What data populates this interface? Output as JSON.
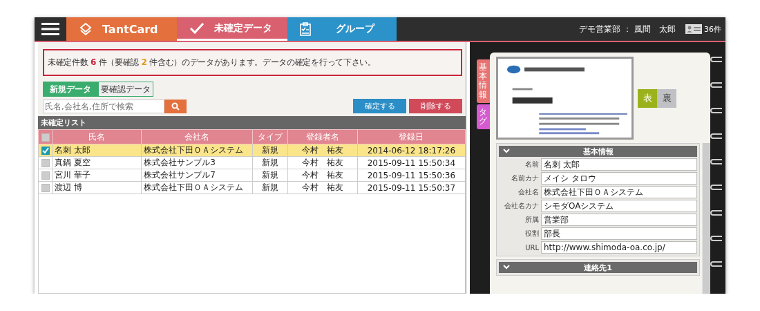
{
  "header": {
    "tabs": [
      {
        "kind": "brand",
        "label": "TantCard",
        "selected": false
      },
      {
        "kind": "check",
        "label": "未確定データ",
        "selected": true
      },
      {
        "kind": "group",
        "label": "グループ",
        "selected": false
      }
    ],
    "user": "デモ営業部 ： 風間　太郎",
    "count": "36件"
  },
  "notice": "未確定件数 **6** 件（要確認 **2** 件含む）のデータがあります。データの確定を行って下さい。",
  "subtabs": [
    {
      "label": "新規データ",
      "selected": true
    },
    {
      "label": "要確認データ",
      "selected": false
    }
  ],
  "search": {
    "placeholder": "氏名,会社名,住所で検索"
  },
  "buttons": [
    {
      "kind": "confirm",
      "label": "確定する"
    },
    {
      "kind": "delete",
      "label": "削除する"
    }
  ],
  "list": {
    "title": "未確定リスト",
    "all_checked": false,
    "columns": [
      "氏名",
      "会社名",
      "タイプ",
      "登録者名",
      "登録日"
    ],
    "rows": [
      {
        "checked": true,
        "selected": true,
        "cells": [
          "名刺 太郎",
          "株式会社下田ＯＡシステム",
          "新規",
          "今村　祐友",
          "2014-06-12 18:17:26"
        ]
      },
      {
        "checked": false,
        "selected": false,
        "cells": [
          "真鍋 夏空",
          "株式会社サンプル3",
          "新規",
          "今村　祐友",
          "2015-09-11 15:50:34"
        ]
      },
      {
        "checked": false,
        "selected": false,
        "cells": [
          "宮川 華子",
          "株式会社サンプル7",
          "新規",
          "今村　祐友",
          "2015-09-11 15:50:36"
        ]
      },
      {
        "checked": false,
        "selected": false,
        "cells": [
          "渡辺 博",
          "株式会社下田ＯＡシステム",
          "新規",
          "今村　祐友",
          "2015-09-11 15:50:37"
        ]
      }
    ]
  },
  "detail": {
    "side_tabs": [
      {
        "label": "基本情報",
        "color": "#e87272"
      },
      {
        "label": "タグ",
        "color": "#d65bd0"
      }
    ],
    "card_faces": [
      {
        "label": "表",
        "selected": true
      },
      {
        "label": "裏",
        "selected": false
      }
    ],
    "sections": [
      {
        "title": "基本情報",
        "fields": [
          {
            "label": "名前",
            "value": "名刺 太郎"
          },
          {
            "label": "名前カナ",
            "value": "メイシ タロウ"
          },
          {
            "label": "会社名",
            "value": "株式会社下田ＯＡシステム"
          },
          {
            "label": "会社名カナ",
            "value": "シモダOAシステム"
          },
          {
            "label": "所属",
            "value": "営業部"
          },
          {
            "label": "役割",
            "value": "部長"
          },
          {
            "label": "URL",
            "value": "http://www.shimoda-oa.co.jp/"
          }
        ]
      },
      {
        "title": "連絡先1"
      }
    ]
  }
}
